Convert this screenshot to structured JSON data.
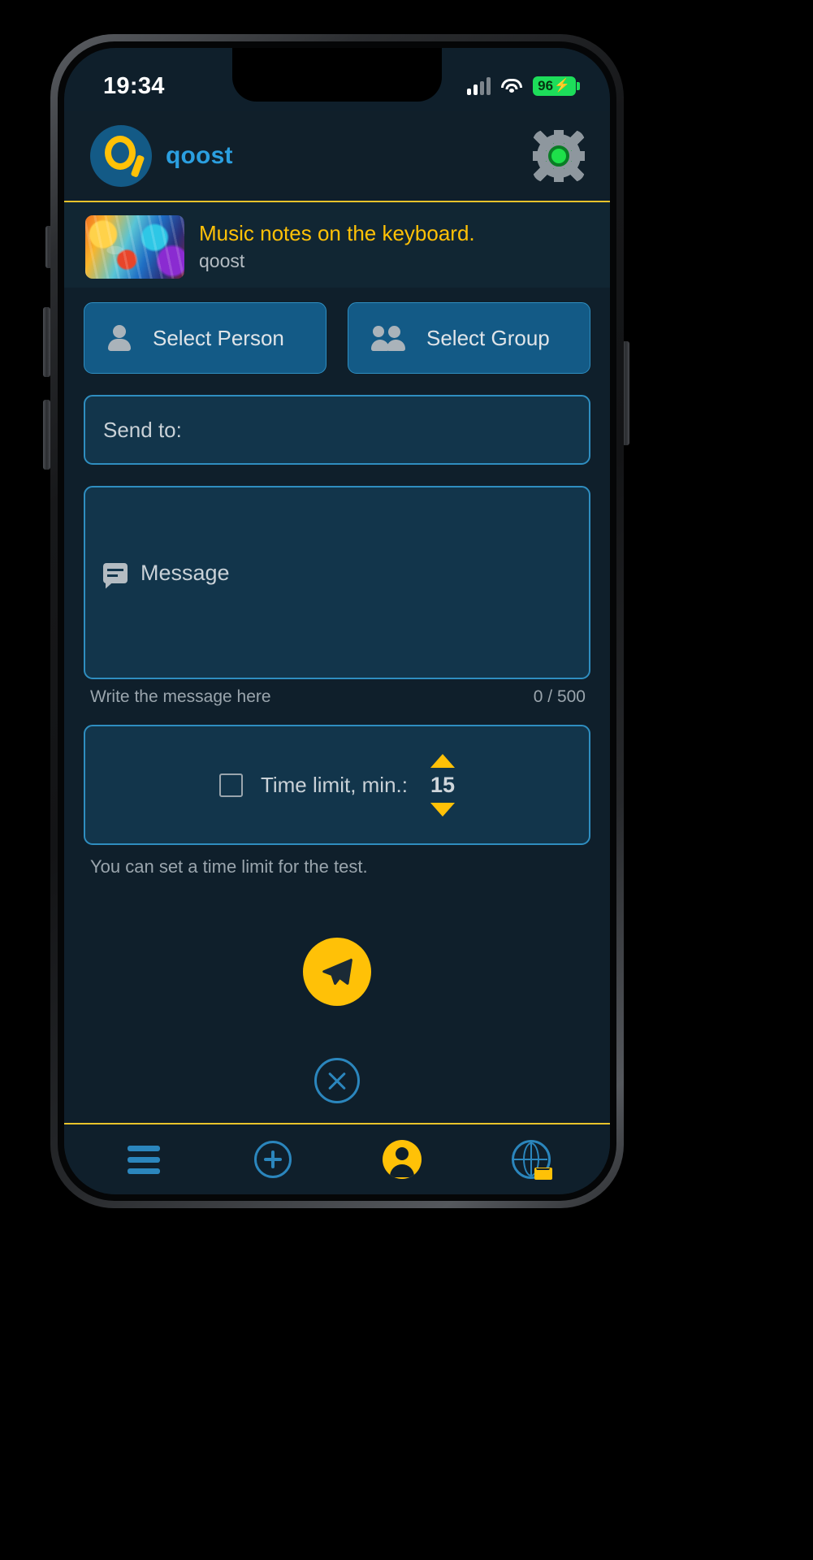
{
  "statusbar": {
    "time": "19:34",
    "signal_icon": "signal-bars-icon",
    "wifi_icon": "wifi-icon",
    "battery_level": "96",
    "battery_bolt": "⚡",
    "battery_color": "#1ddd5a"
  },
  "header": {
    "logo_icon": "qoost-logo-icon",
    "brand_name": "qoost",
    "brand_color": "#2b9fe0",
    "settings_icon": "gear-icon"
  },
  "content_card": {
    "thumbnail_icon": "music-artwork-thumbnail",
    "title": "Music notes on the keyboard.",
    "title_color": "#ffc107",
    "subtitle": "qoost",
    "divider_color": "#e8c32b"
  },
  "actions": {
    "select_person_label": "Select Person",
    "select_person_icon": "person-icon",
    "select_group_label": "Select Group",
    "select_group_icon": "group-icon",
    "button_color": "#135a86"
  },
  "form": {
    "send_to_label": "Send to:",
    "send_to_value": "",
    "message_placeholder": "Message",
    "message_icon": "chat-bubble-icon",
    "message_value": "",
    "message_helper": "Write the message here",
    "message_counter": "0 / 500",
    "time_limit_checked": false,
    "time_limit_label": "Time limit, min.:",
    "time_limit_value": "15",
    "stepper_up_icon": "triangle-up-icon",
    "stepper_down_icon": "triangle-down-icon",
    "time_limit_note": "You can set a time limit for the test."
  },
  "footer_actions": {
    "send_icon": "paper-plane-icon",
    "send_color": "#ffc107",
    "cancel_icon": "close-circle-icon",
    "cancel_color": "#2b86bd"
  },
  "bottom_nav": {
    "items": [
      {
        "name": "menu",
        "icon": "hamburger-menu-icon"
      },
      {
        "name": "add",
        "icon": "plus-circle-icon"
      },
      {
        "name": "profile",
        "icon": "profile-avatar-icon"
      },
      {
        "name": "mail",
        "icon": "globe-mail-icon"
      }
    ]
  }
}
